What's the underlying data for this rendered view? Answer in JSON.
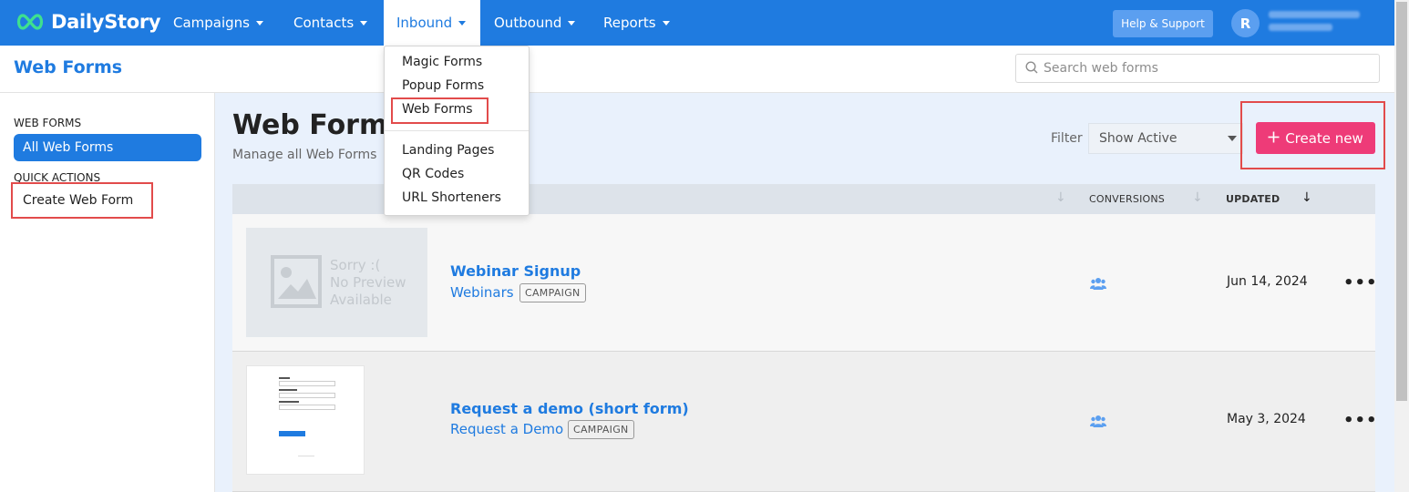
{
  "app": {
    "name": "DailyStory"
  },
  "nav": {
    "items": [
      {
        "label": "Campaigns"
      },
      {
        "label": "Contacts"
      },
      {
        "label": "Inbound"
      },
      {
        "label": "Outbound"
      },
      {
        "label": "Reports"
      }
    ],
    "help_label": "Help & Support",
    "avatar_initial": "R"
  },
  "header": {
    "title": "Web Forms",
    "search_placeholder": "Search web forms"
  },
  "sidebar": {
    "section1_heading": "WEB FORMS",
    "active_item": "All Web Forms",
    "section2_heading": "QUICK ACTIONS",
    "action_item": "Create Web Form"
  },
  "main": {
    "title": "Web Forms",
    "subtitle": "Manage all Web Forms",
    "filter_label": "Filter",
    "filter_value": "Show Active",
    "create_label": "Create new"
  },
  "table": {
    "columns": {
      "conversions": "CONVERSIONS",
      "updated": "UPDATED"
    },
    "no_preview": [
      "Sorry :(",
      "No Preview",
      "Available"
    ],
    "rows": [
      {
        "title": "Webinar Signup",
        "campaign": "Webinars",
        "badge": "CAMPAIGN",
        "updated": "Jun 14, 2024",
        "more": "•••"
      },
      {
        "title": "Request a demo (short form)",
        "campaign": "Request a Demo",
        "badge": "CAMPAIGN",
        "updated": "May 3, 2024",
        "more": "•••"
      }
    ]
  },
  "dropdown": {
    "items": [
      "Magic Forms",
      "Popup Forms",
      "Web Forms"
    ],
    "items2": [
      "Landing Pages",
      "QR Codes",
      "URL Shorteners"
    ]
  },
  "colors": {
    "brand": "#1f7be0",
    "accent": "#ee3b78",
    "highlight": "#e24b4b"
  }
}
